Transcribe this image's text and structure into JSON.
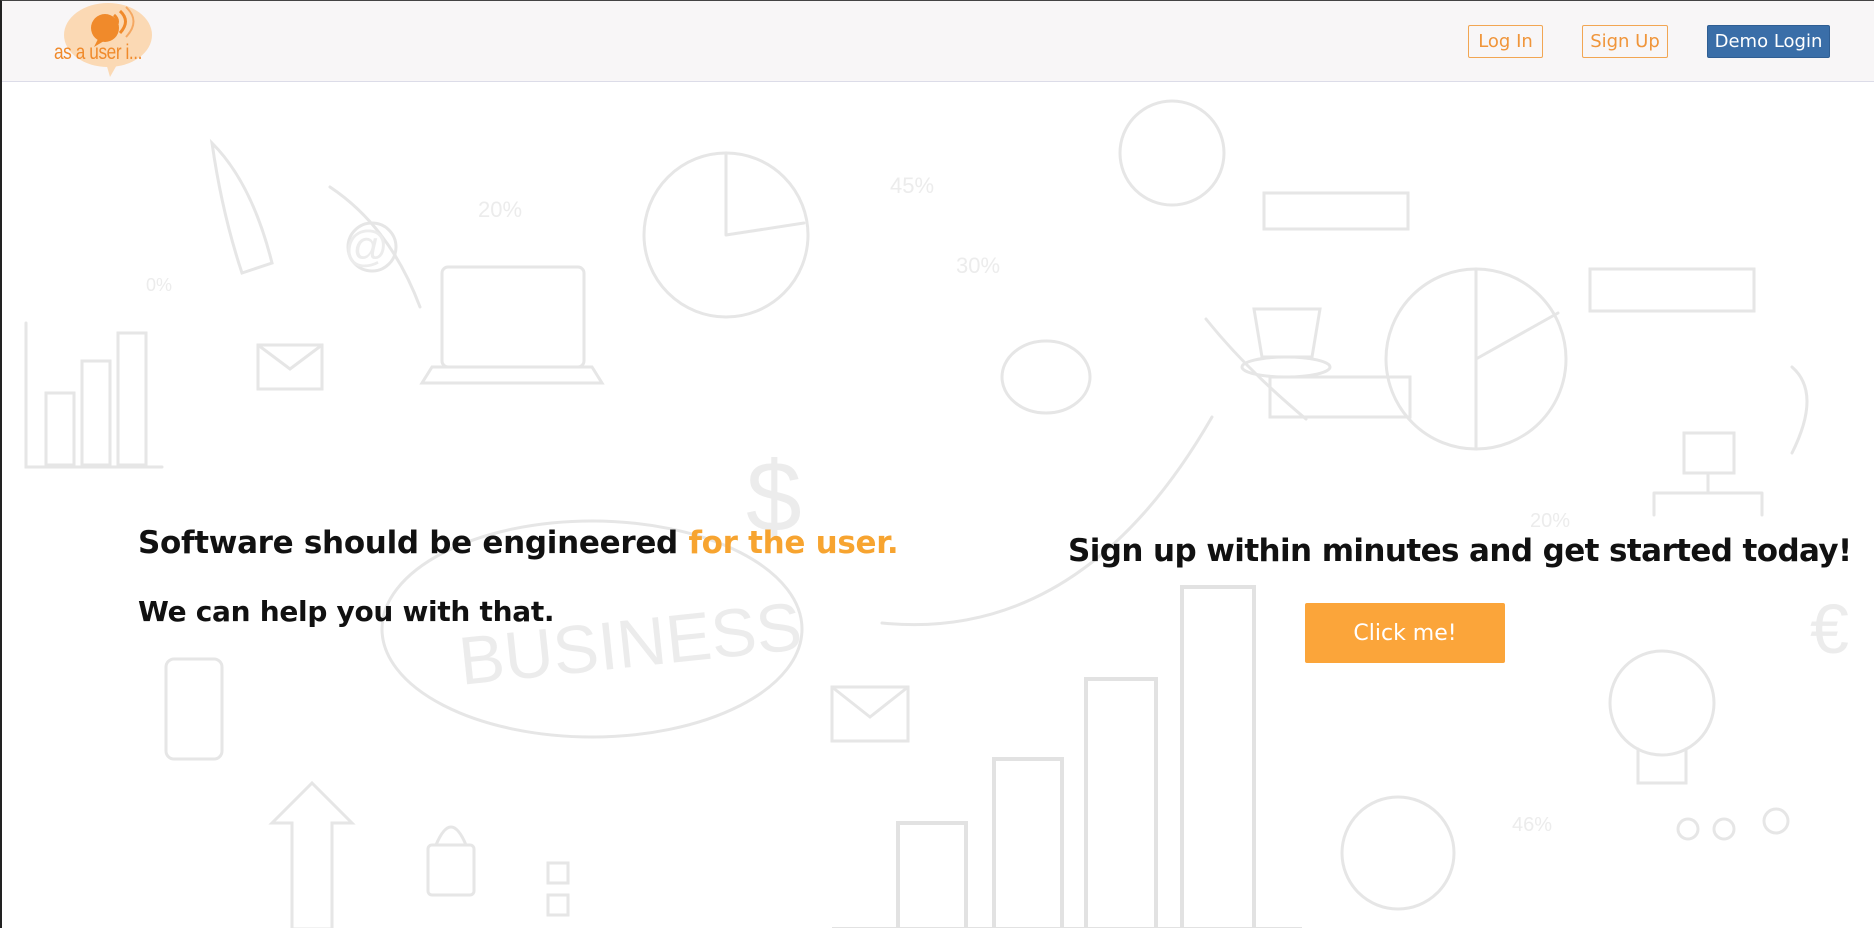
{
  "brand": {
    "logo_text": "as a user i...",
    "accent_color": "#f7a430",
    "primary_color": "#3a6ea8"
  },
  "nav": {
    "login_label": "Log In",
    "signup_label": "Sign Up",
    "demo_login_label": "Demo Login"
  },
  "hero": {
    "tagline_prefix": "Software should be engineered ",
    "tagline_accent": "for the user.",
    "subline": "We can help you with that.",
    "cta_heading": "Sign up within minutes and get started today!",
    "cta_button_label": "Click me!"
  },
  "background": {
    "doodle_text": [
      "BUSINESS",
      "$",
      "@",
      "€",
      "45%",
      "30%",
      "20%",
      "46%",
      "20%",
      "0%"
    ]
  },
  "icons": {
    "logo": "speech-bubble-icon",
    "background": "business-doodles"
  }
}
